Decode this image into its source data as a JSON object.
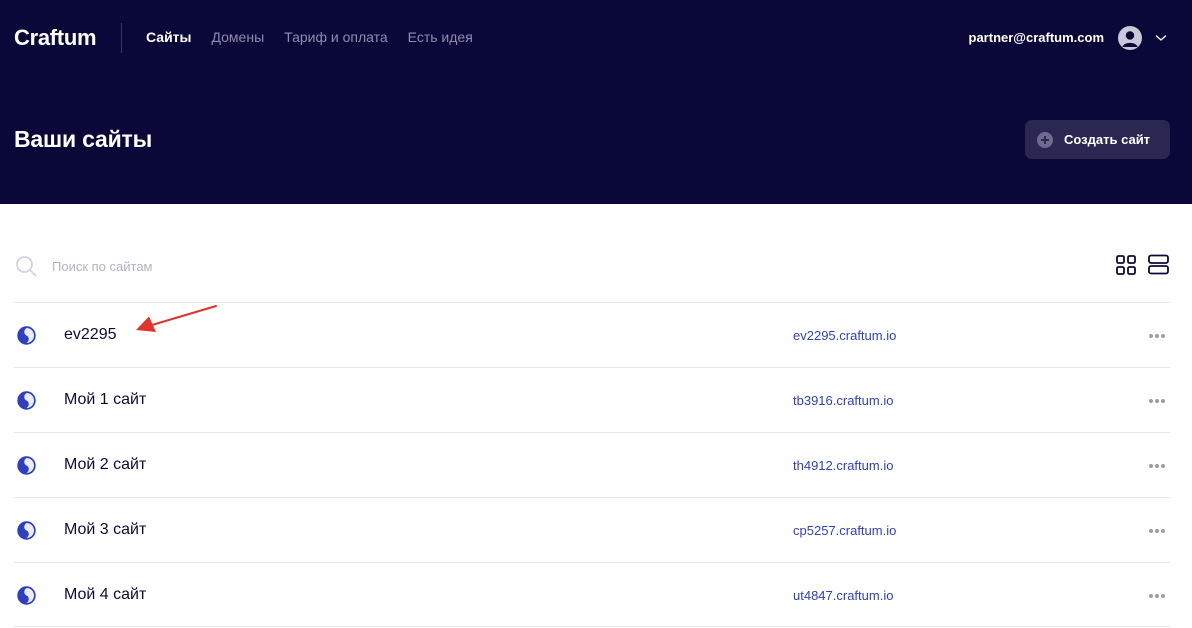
{
  "app": {
    "logo": "Craftum",
    "nav": [
      {
        "label": "Сайты",
        "active": true
      },
      {
        "label": "Домены",
        "active": false
      },
      {
        "label": "Тариф и оплата",
        "active": false
      },
      {
        "label": "Есть идея",
        "active": false
      }
    ],
    "user_email": "partner@craftum.com"
  },
  "page": {
    "title": "Ваши сайты",
    "create_button": "Создать сайт"
  },
  "search": {
    "placeholder": "Поиск по сайтам",
    "value": ""
  },
  "sites": [
    {
      "name": "ev2295",
      "domain": "ev2295.craftum.io"
    },
    {
      "name": "Мой 1 сайт",
      "domain": "tb3916.craftum.io"
    },
    {
      "name": "Мой 2 сайт",
      "domain": "th4912.craftum.io"
    },
    {
      "name": "Мой 3 сайт",
      "domain": "cp5257.craftum.io"
    },
    {
      "name": "Мой 4 сайт",
      "domain": "ut4847.craftum.io"
    }
  ],
  "colors": {
    "header_bg": "#0a0838",
    "accent": "#2f3fc2",
    "annotation_arrow": "#e0342a"
  },
  "icons": {
    "search": "search-icon",
    "grid_view": "grid-view-icon",
    "list_view": "list-view-icon",
    "site": "globe-icon",
    "menu": "more-dots-icon",
    "avatar": "user-avatar-icon",
    "chevron": "chevron-down-icon",
    "plus": "plus-circle-icon"
  }
}
